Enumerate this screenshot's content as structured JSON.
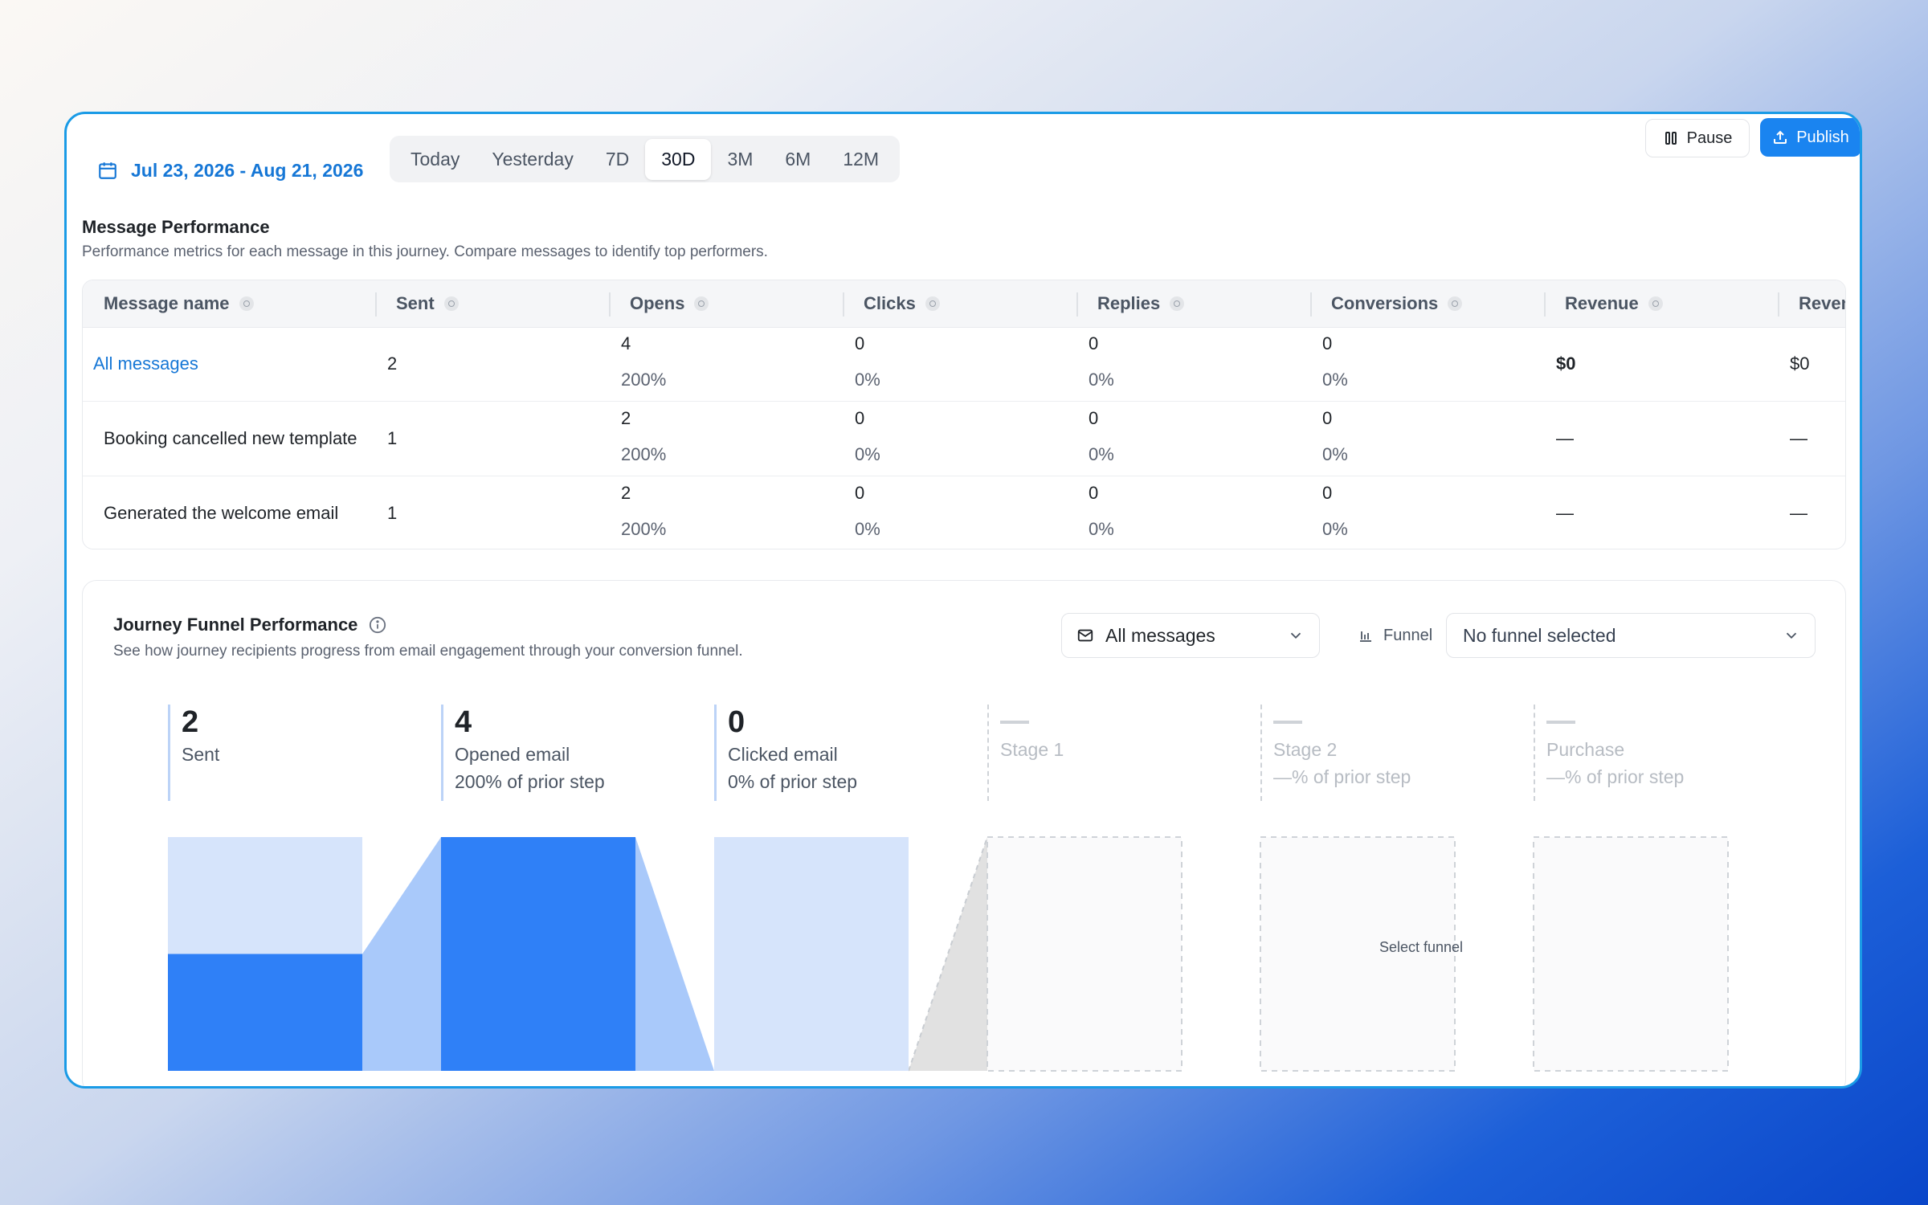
{
  "toolbar": {
    "date_range": "Jul 23, 2026 - Aug 21, 2026",
    "ranges": [
      "Today",
      "Yesterday",
      "7D",
      "30D",
      "3M",
      "6M",
      "12M"
    ],
    "active_range": "30D",
    "pause_label": "Pause",
    "publish_label": "Publish"
  },
  "message_performance": {
    "title": "Message Performance",
    "description": "Performance metrics for each message in this journey. Compare messages to identify top performers.",
    "columns": [
      "Message name",
      "Sent",
      "Opens",
      "Clicks",
      "Replies",
      "Conversions",
      "Revenue",
      "Reven"
    ],
    "rows": [
      {
        "name": "All messages",
        "sent": "2",
        "opens": "4",
        "opens_pct": "200%",
        "clicks": "0",
        "clicks_pct": "0%",
        "replies": "0",
        "replies_pct": "0%",
        "conversions": "0",
        "conversions_pct": "0%",
        "revenue": "$0",
        "revenue2": "$0"
      },
      {
        "name": "Booking cancelled new template",
        "sent": "1",
        "opens": "2",
        "opens_pct": "200%",
        "clicks": "0",
        "clicks_pct": "0%",
        "replies": "0",
        "replies_pct": "0%",
        "conversions": "0",
        "conversions_pct": "0%",
        "revenue": "—",
        "revenue2": "—"
      },
      {
        "name": "Generated the welcome email",
        "sent": "1",
        "opens": "2",
        "opens_pct": "200%",
        "clicks": "0",
        "clicks_pct": "0%",
        "replies": "0",
        "replies_pct": "0%",
        "conversions": "0",
        "conversions_pct": "0%",
        "revenue": "—",
        "revenue2": "—"
      }
    ]
  },
  "funnel": {
    "title": "Journey Funnel Performance",
    "description": "See how journey recipients progress from email engagement through your conversion funnel.",
    "message_select": "All messages",
    "funnel_label": "Funnel",
    "funnel_select": "No funnel selected",
    "stages": [
      {
        "value": "2",
        "label": "Sent",
        "sub": ""
      },
      {
        "value": "4",
        "label": "Opened email",
        "sub": "200% of prior step"
      },
      {
        "value": "0",
        "label": "Clicked email",
        "sub": "0% of prior step"
      },
      {
        "value": "",
        "label": "Stage 1",
        "sub": ""
      },
      {
        "value": "",
        "label": "Stage 2",
        "sub": "—% of prior step"
      },
      {
        "value": "",
        "label": "Purchase",
        "sub": "—% of prior step"
      }
    ],
    "placeholder_text": "Select funnel",
    "bar_fill_fractions": [
      0.5,
      1.0,
      0.0
    ],
    "colors": {
      "primary": "#2f80f7",
      "light": "#d6e4fb",
      "connector": "#a9c9fa",
      "ghost": "#e1e1e1"
    }
  }
}
